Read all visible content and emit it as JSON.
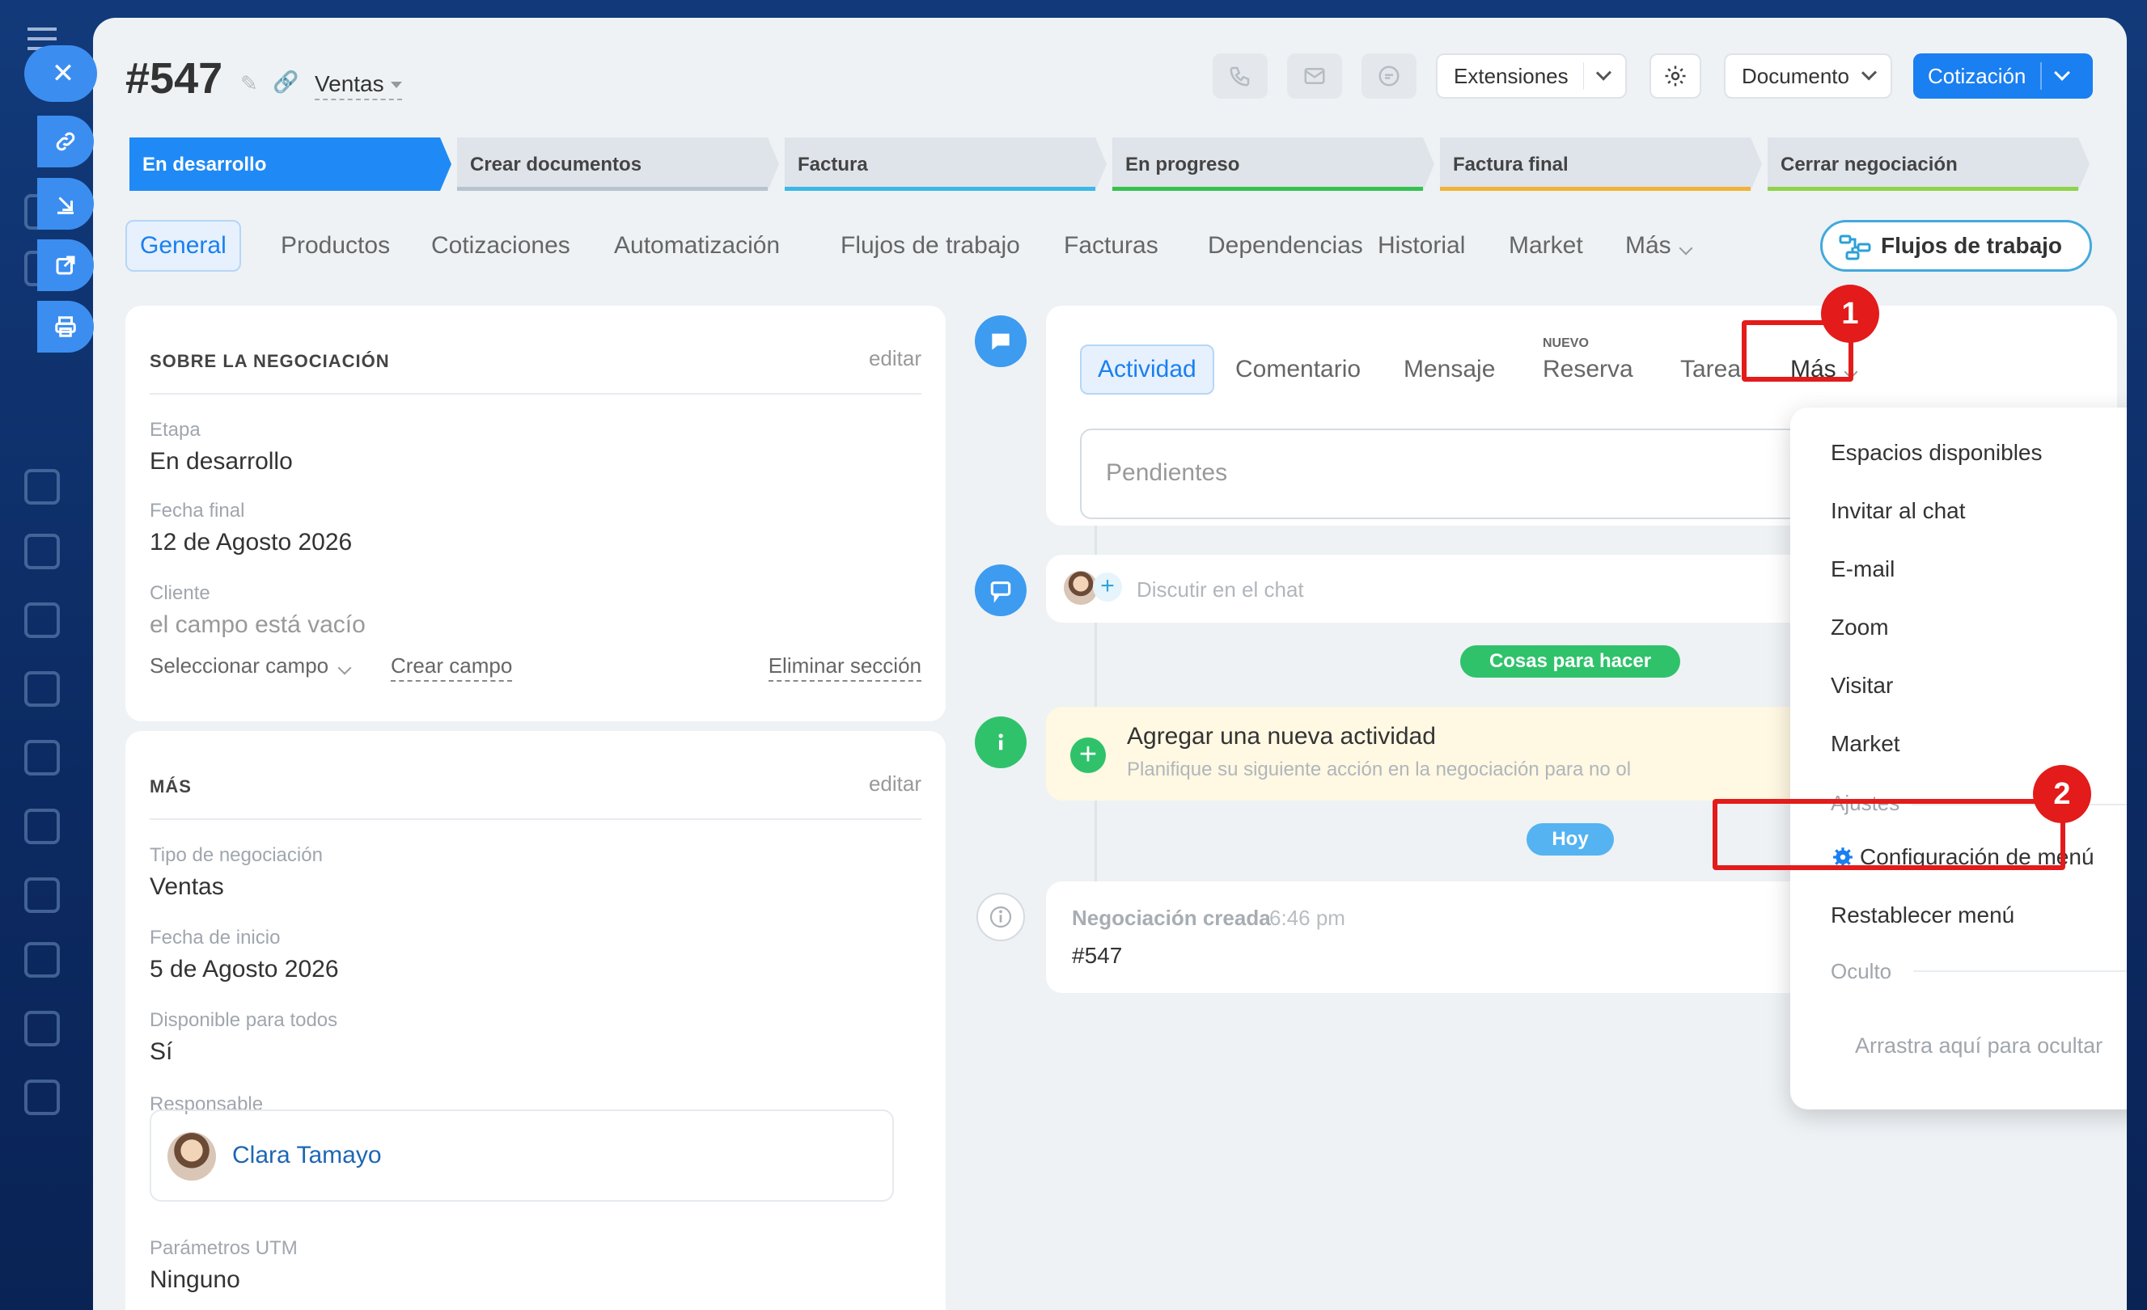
{
  "deal": {
    "title": "#547",
    "category": "Ventas"
  },
  "toolbar": {
    "extensiones": "Extensiones",
    "documento": "Documento",
    "cotizacion": "Cotización"
  },
  "stages": [
    {
      "label": "En desarrollo",
      "color": "#1f8af5"
    },
    {
      "label": "Crear documentos",
      "color": "#b7c3cf"
    },
    {
      "label": "Factura",
      "color": "#3cb8e6"
    },
    {
      "label": "En progreso",
      "color": "#35c24e"
    },
    {
      "label": "Factura final",
      "color": "#f2b234"
    },
    {
      "label": "Cerrar negociación",
      "color": "#8fd34a"
    }
  ],
  "tabs": [
    "General",
    "Productos",
    "Cotizaciones",
    "Automatización",
    "Flujos de trabajo",
    "Facturas",
    "Dependencias",
    "Historial",
    "Market",
    "Más"
  ],
  "flujos_button": "Flujos de trabajo",
  "about": {
    "heading": "SOBRE LA NEGOCIACIÓN",
    "edit": "editar",
    "fields": [
      {
        "label": "Etapa",
        "value": "En desarrollo"
      },
      {
        "label": "Fecha final",
        "value": "12 de Agosto 2026"
      },
      {
        "label": "Cliente",
        "value": "el campo está vacío"
      }
    ],
    "select_field": "Seleccionar campo",
    "create_field": "Crear campo",
    "delete_section": "Eliminar sección"
  },
  "more": {
    "heading": "MÁS",
    "edit": "editar",
    "fields": [
      {
        "label": "Tipo de negociación",
        "value": "Ventas"
      },
      {
        "label": "Fecha de inicio",
        "value": "5 de Agosto 2026"
      },
      {
        "label": "Disponible para todos",
        "value": "Sí"
      },
      {
        "label": "Responsable",
        "value": "Clara Tamayo"
      },
      {
        "label": "Parámetros UTM",
        "value": "Ninguno"
      }
    ]
  },
  "activity": {
    "tabs": [
      "Actividad",
      "Comentario",
      "Mensaje",
      "Reserva",
      "Tarea",
      "Más"
    ],
    "nuevo": "NUEVO",
    "placeholder": "Pendientes"
  },
  "chat": {
    "placeholder": "Discutir en el chat"
  },
  "todo_pill": "Cosas para hacer",
  "todo": {
    "title": "Agregar una nueva actividad",
    "subtitle": "Planifique su siguiente acción en la negociación para no ol"
  },
  "hoy_pill": "Hoy",
  "created": {
    "title": "Negociación creada",
    "time": "6:46 pm",
    "value": "#547"
  },
  "menu": {
    "items": [
      "Espacios disponibles",
      "Invitar al chat",
      "E-mail",
      "Zoom",
      "Visitar",
      "Market"
    ],
    "ajustes": "Ajustes",
    "config": "Configuración de menú",
    "restablecer": "Restablecer menú",
    "oculto": "Oculto",
    "drag": "Arrastra aquí para ocultar"
  },
  "annotations": [
    "1",
    "2"
  ],
  "colors": {
    "accent": "#1a7ff0",
    "highlight": "#e31b1b",
    "green": "#2fc26b",
    "pill_blue": "#55b3f2"
  }
}
